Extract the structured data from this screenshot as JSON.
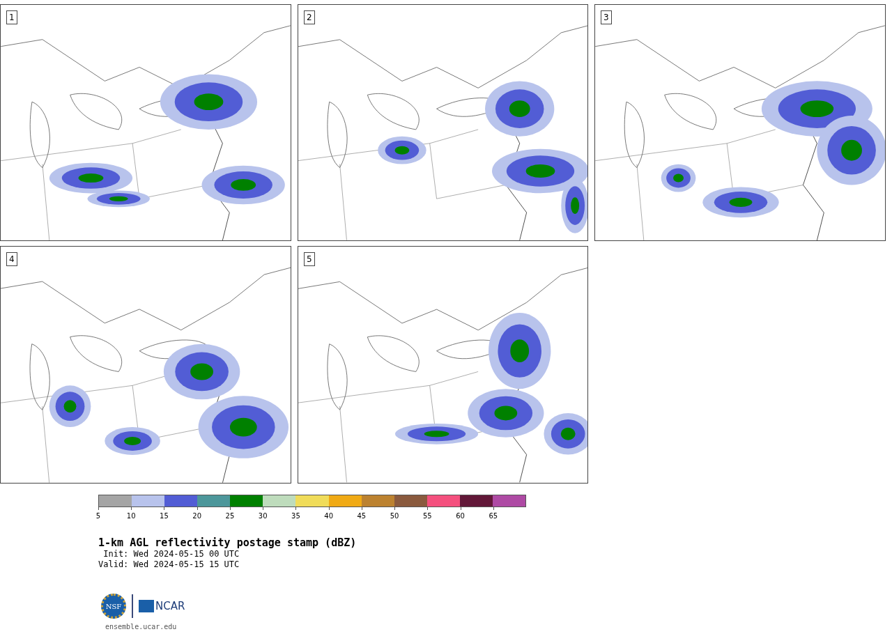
{
  "panels": [
    {
      "label": "1"
    },
    {
      "label": "2"
    },
    {
      "label": "3"
    },
    {
      "label": "4"
    },
    {
      "label": "5"
    }
  ],
  "colorbar": {
    "bins": [
      {
        "tick": "5",
        "color": "#a5a5a5"
      },
      {
        "tick": "10",
        "color": "#b8c3ec"
      },
      {
        "tick": "15",
        "color": "#525dd5"
      },
      {
        "tick": "20",
        "color": "#4d979b"
      },
      {
        "tick": "25",
        "color": "#008000"
      },
      {
        "tick": "30",
        "color": "#bedcbc"
      },
      {
        "tick": "35",
        "color": "#f0dc5a"
      },
      {
        "tick": "40",
        "color": "#f0aa15"
      },
      {
        "tick": "45",
        "color": "#bc8230"
      },
      {
        "tick": "50",
        "color": "#8a5a3e"
      },
      {
        "tick": "55",
        "color": "#f4507e"
      },
      {
        "tick": "60",
        "color": "#621838"
      },
      {
        "tick": "65",
        "color": "#ae4aa4"
      }
    ]
  },
  "title": "1-km AGL reflectivity postage stamp (dBZ)",
  "init": " Init: Wed 2024-05-15 00 UTC",
  "valid": "Valid: Wed 2024-05-15 15 UTC",
  "logo": {
    "left": "NSF",
    "right": "NCAR"
  },
  "url": "ensemble.ucar.edu"
}
